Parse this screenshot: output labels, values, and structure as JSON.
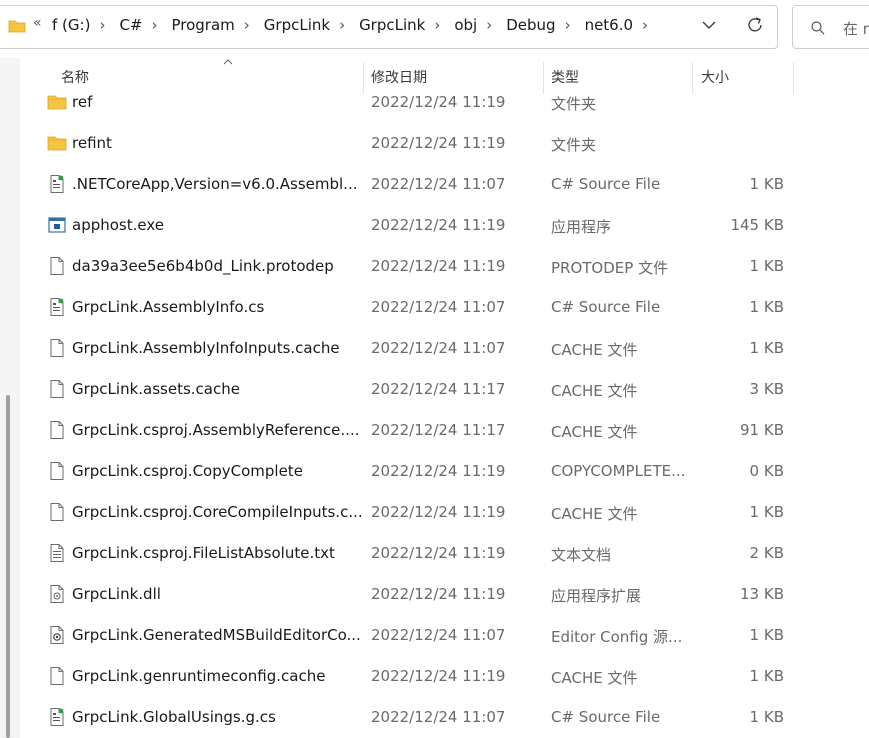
{
  "address_bar": {
    "overflow_label": "«",
    "crumbs": [
      "f (G:)",
      "C#",
      "Program",
      "GrpcLink",
      "GrpcLink",
      "obj",
      "Debug",
      "net6.0"
    ]
  },
  "search": {
    "placeholder": "在 n"
  },
  "columns": {
    "name": "名称",
    "date": "修改日期",
    "type": "类型",
    "size": "大小"
  },
  "files": [
    {
      "name": "ref",
      "date": "2022/12/24 11:19",
      "type": "文件夹",
      "size": "",
      "icon": "folder-icon"
    },
    {
      "name": "refint",
      "date": "2022/12/24 11:19",
      "type": "文件夹",
      "size": "",
      "icon": "folder-icon"
    },
    {
      "name": ".NETCoreApp,Version=v6.0.Assembl...",
      "date": "2022/12/24 11:07",
      "type": "C# Source File",
      "size": "1 KB",
      "icon": "csharp-file-icon"
    },
    {
      "name": "apphost.exe",
      "date": "2022/12/24 11:19",
      "type": "应用程序",
      "size": "145 KB",
      "icon": "exe-icon"
    },
    {
      "name": "da39a3ee5e6b4b0d_Link.protodep",
      "date": "2022/12/24 11:19",
      "type": "PROTODEP 文件",
      "size": "1 KB",
      "icon": "file-icon"
    },
    {
      "name": "GrpcLink.AssemblyInfo.cs",
      "date": "2022/12/24 11:07",
      "type": "C# Source File",
      "size": "1 KB",
      "icon": "csharp-file-icon"
    },
    {
      "name": "GrpcLink.AssemblyInfoInputs.cache",
      "date": "2022/12/24 11:07",
      "type": "CACHE 文件",
      "size": "1 KB",
      "icon": "file-icon"
    },
    {
      "name": "GrpcLink.assets.cache",
      "date": "2022/12/24 11:17",
      "type": "CACHE 文件",
      "size": "3 KB",
      "icon": "file-icon"
    },
    {
      "name": "GrpcLink.csproj.AssemblyReference....",
      "date": "2022/12/24 11:17",
      "type": "CACHE 文件",
      "size": "91 KB",
      "icon": "file-icon"
    },
    {
      "name": "GrpcLink.csproj.CopyComplete",
      "date": "2022/12/24 11:19",
      "type": "COPYCOMPLETE...",
      "size": "0 KB",
      "icon": "file-icon"
    },
    {
      "name": "GrpcLink.csproj.CoreCompileInputs.c...",
      "date": "2022/12/24 11:19",
      "type": "CACHE 文件",
      "size": "1 KB",
      "icon": "file-icon"
    },
    {
      "name": "GrpcLink.csproj.FileListAbsolute.txt",
      "date": "2022/12/24 11:19",
      "type": "文本文档",
      "size": "2 KB",
      "icon": "text-file-icon"
    },
    {
      "name": "GrpcLink.dll",
      "date": "2022/12/24 11:19",
      "type": "应用程序扩展",
      "size": "13 KB",
      "icon": "dll-icon"
    },
    {
      "name": "GrpcLink.GeneratedMSBuildEditorCo...",
      "date": "2022/12/24 11:07",
      "type": "Editor Config 源...",
      "size": "1 KB",
      "icon": "config-file-icon"
    },
    {
      "name": "GrpcLink.genruntimeconfig.cache",
      "date": "2022/12/24 11:19",
      "type": "CACHE 文件",
      "size": "1 KB",
      "icon": "file-icon"
    },
    {
      "name": "GrpcLink.GlobalUsings.g.cs",
      "date": "2022/12/24 11:07",
      "type": "C# Source File",
      "size": "1 KB",
      "icon": "csharp-file-icon"
    }
  ]
}
